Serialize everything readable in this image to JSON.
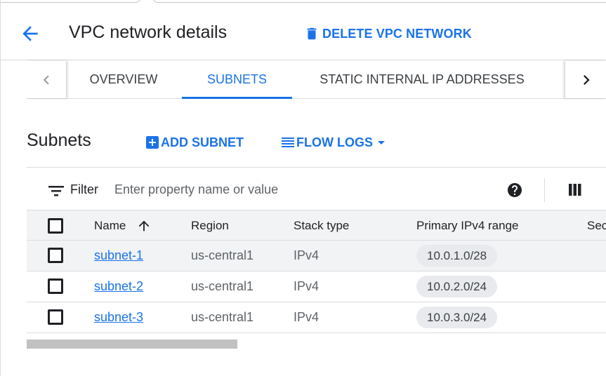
{
  "header": {
    "title": "VPC network details",
    "delete_label": "DELETE VPC NETWORK"
  },
  "tabs": [
    {
      "label": "OVERVIEW",
      "active": false
    },
    {
      "label": "SUBNETS",
      "active": true
    },
    {
      "label": "STATIC INTERNAL IP ADDRESSES",
      "active": false
    }
  ],
  "subnets_section": {
    "title": "Subnets",
    "add_label": "ADD SUBNET",
    "flow_logs_label": "FLOW LOGS"
  },
  "filter": {
    "label": "Filter",
    "placeholder": "Enter property name or value"
  },
  "table": {
    "columns": [
      "Name",
      "Region",
      "Stack type",
      "Primary IPv4 range",
      "Sec"
    ],
    "sort_column": "Name",
    "sort_direction": "ascending",
    "rows": [
      {
        "name": "subnet-1",
        "region": "us-central1",
        "stack": "IPv4",
        "range": "10.0.1.0/28"
      },
      {
        "name": "subnet-2",
        "region": "us-central1",
        "stack": "IPv4",
        "range": "10.0.2.0/24"
      },
      {
        "name": "subnet-3",
        "region": "us-central1",
        "stack": "IPv4",
        "range": "10.0.3.0/24"
      }
    ]
  },
  "colors": {
    "accent": "#1a73e8",
    "text": "#202124",
    "muted": "#5f6368",
    "header_bg": "#f1f3f4",
    "chip_bg": "#e8eaed"
  },
  "icons": [
    "arrow-back-icon",
    "trash-icon",
    "chevron-left-icon",
    "chevron-right-icon",
    "add-box-icon",
    "menu-lines-icon",
    "arrow-drop-down-icon",
    "filter-list-icon",
    "help-icon",
    "column-display-icon",
    "arrow-upward-icon"
  ]
}
